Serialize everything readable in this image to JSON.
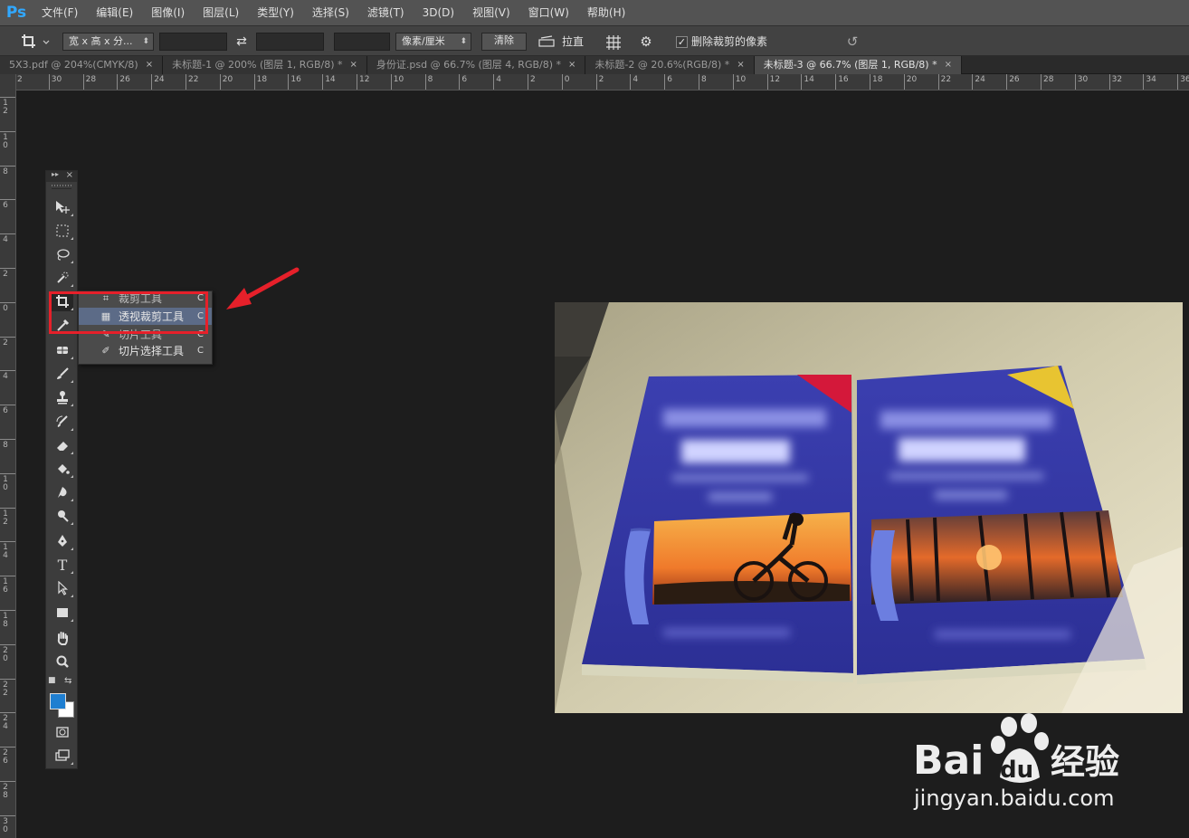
{
  "app": {
    "logo": "Ps"
  },
  "menu": [
    "文件(F)",
    "编辑(E)",
    "图像(I)",
    "图层(L)",
    "类型(Y)",
    "选择(S)",
    "滤镜(T)",
    "3D(D)",
    "视图(V)",
    "窗口(W)",
    "帮助(H)"
  ],
  "options": {
    "ratio_select": "宽 x 高 x 分...",
    "width_value": "",
    "height_value": "",
    "resolution_value": "",
    "unit_select": "像素/厘米",
    "clear_button": "清除",
    "straighten_label": "拉直",
    "delete_pixels_label": "删除裁剪的像素",
    "delete_pixels_checked": true
  },
  "tabs": [
    {
      "label": "5X3.pdf @ 204%(CMYK/8)",
      "close": "×",
      "active": false
    },
    {
      "label": "未标题-1 @ 200% (图层 1, RGB/8) *",
      "close": "×",
      "active": false
    },
    {
      "label": "身份证.psd @ 66.7% (图层 4, RGB/8) *",
      "close": "×",
      "active": false
    },
    {
      "label": "未标题-2 @ 20.6%(RGB/8) *",
      "close": "×",
      "active": false
    },
    {
      "label": "未标题-3 @ 66.7% (图层 1, RGB/8) *",
      "close": "×",
      "active": true
    }
  ],
  "ruler_h": [
    "2",
    "30",
    "28",
    "26",
    "24",
    "22",
    "20",
    "18",
    "16",
    "14",
    "12",
    "10",
    "8",
    "6",
    "4",
    "2",
    "0",
    "2",
    "4",
    "6",
    "8",
    "10",
    "12",
    "14",
    "16",
    "18",
    "20",
    "22",
    "24",
    "26",
    "28",
    "30",
    "32",
    "34",
    "36"
  ],
  "ruler_v": [
    "12",
    "10",
    "8",
    "6",
    "4",
    "2",
    "0",
    "2",
    "4",
    "6",
    "8",
    "10",
    "12",
    "14",
    "16",
    "18",
    "20",
    "22",
    "24",
    "26",
    "28",
    "30"
  ],
  "flyout": {
    "items": [
      {
        "label": "裁剪工具",
        "key": "C"
      },
      {
        "label": "透视裁剪工具",
        "key": "C"
      },
      {
        "label": "切片工具",
        "key": "C"
      },
      {
        "label": "切片选择工具",
        "key": "C"
      }
    ]
  },
  "colors": {
    "foreground": "#1f7fd1",
    "background": "#ffffff",
    "annotation": "#e6202a",
    "menu_selected": "#5c6b87"
  },
  "watermark": {
    "brand": "Bai",
    "brand2": "du",
    "suffix": "经验",
    "url": "jingyan.baidu.com"
  }
}
